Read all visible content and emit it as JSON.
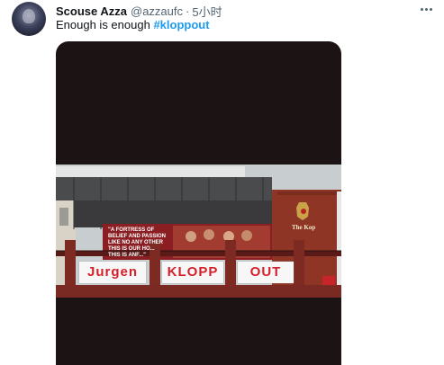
{
  "tweet": {
    "display_name": "Scouse Azza",
    "handle": "@azzaufc",
    "separator": "·",
    "time": "5小时",
    "text": "Enough is enough",
    "hashtag": "#kloppout"
  },
  "media": {
    "mural_lines": "\"A FORTRESS OF\nBELIEF AND PASSION\nLIKE NO ANY OTHER\nTHIS IS OUR HO...\nTHIS IS ANF...\"",
    "kop_sign": "The Kop",
    "banners": [
      "Jurgen",
      "KLOPP",
      "OUT"
    ]
  },
  "colors": {
    "hashtag": "#1d9bf0",
    "name": "#0f1419",
    "muted": "#536471",
    "banner_text": "#d4202a",
    "brick": "#8e3526"
  },
  "icons": {
    "more": "more-dots-icon",
    "crest": "lfc-crest-icon"
  }
}
